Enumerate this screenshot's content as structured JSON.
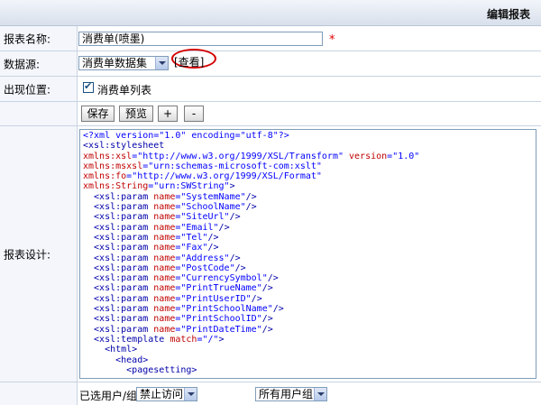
{
  "header": {
    "title": "编辑报表"
  },
  "form": {
    "name_label": "报表名称:",
    "name_value": "消费单(喷墨)",
    "required_mark": "*",
    "datasource_label": "数据源:",
    "datasource_value": "消费单数据集",
    "view_link": "[查看]",
    "position_label": "出现位置:",
    "position_checkbox_label": "消费单列表",
    "position_checked": true,
    "buttons": {
      "save": "保存",
      "preview": "预览",
      "plus": "+",
      "minus": "-"
    },
    "design_label": "报表设计:",
    "users_label": "已选用户/组",
    "users_select_value": "禁止访问",
    "all_groups_select_value": "所有用户组"
  },
  "code_lines": [
    [
      {
        "t": "<?xml version=\"1.0\" encoding=\"utf-8\"?>",
        "c": "pi"
      }
    ],
    [
      {
        "t": "<",
        "c": "tag"
      },
      {
        "t": "xsl:stylesheet",
        "c": "tag"
      }
    ],
    [
      {
        "t": "xmlns:xsl",
        "c": "attr"
      },
      {
        "t": "=\"http://www.w3.org/1999/XSL/Transform\" ",
        "c": "val"
      },
      {
        "t": "version",
        "c": "attr"
      },
      {
        "t": "=\"1.0\"",
        "c": "val"
      }
    ],
    [
      {
        "t": "xmlns:msxsl",
        "c": "attr"
      },
      {
        "t": "=\"urn:schemas-microsoft-com:xslt\"",
        "c": "val"
      }
    ],
    [
      {
        "t": "xmlns:fo",
        "c": "attr"
      },
      {
        "t": "=\"http://www.w3.org/1999/XSL/Format\"",
        "c": "val"
      }
    ],
    [
      {
        "t": "xmlns:String",
        "c": "attr"
      },
      {
        "t": "=\"urn:SWString\"",
        "c": "val"
      },
      {
        "t": ">",
        "c": "tag"
      }
    ],
    [
      {
        "t": "  <xsl:param ",
        "c": "tag"
      },
      {
        "t": "name",
        "c": "attr"
      },
      {
        "t": "=\"SystemName\"",
        "c": "val"
      },
      {
        "t": "/>",
        "c": "tag"
      }
    ],
    [
      {
        "t": "  <xsl:param ",
        "c": "tag"
      },
      {
        "t": "name",
        "c": "attr"
      },
      {
        "t": "=\"SchoolName\"",
        "c": "val"
      },
      {
        "t": "/>",
        "c": "tag"
      }
    ],
    [
      {
        "t": "  <xsl:param ",
        "c": "tag"
      },
      {
        "t": "name",
        "c": "attr"
      },
      {
        "t": "=\"SiteUrl\"",
        "c": "val"
      },
      {
        "t": "/>",
        "c": "tag"
      }
    ],
    [
      {
        "t": "  <xsl:param ",
        "c": "tag"
      },
      {
        "t": "name",
        "c": "attr"
      },
      {
        "t": "=\"Email\"",
        "c": "val"
      },
      {
        "t": "/>",
        "c": "tag"
      }
    ],
    [
      {
        "t": "  <xsl:param ",
        "c": "tag"
      },
      {
        "t": "name",
        "c": "attr"
      },
      {
        "t": "=\"Tel\"",
        "c": "val"
      },
      {
        "t": "/>",
        "c": "tag"
      }
    ],
    [
      {
        "t": "  <xsl:param ",
        "c": "tag"
      },
      {
        "t": "name",
        "c": "attr"
      },
      {
        "t": "=\"Fax\"",
        "c": "val"
      },
      {
        "t": "/>",
        "c": "tag"
      }
    ],
    [
      {
        "t": "  <xsl:param ",
        "c": "tag"
      },
      {
        "t": "name",
        "c": "attr"
      },
      {
        "t": "=\"Address\"",
        "c": "val"
      },
      {
        "t": "/>",
        "c": "tag"
      }
    ],
    [
      {
        "t": "  <xsl:param ",
        "c": "tag"
      },
      {
        "t": "name",
        "c": "attr"
      },
      {
        "t": "=\"PostCode\"",
        "c": "val"
      },
      {
        "t": "/>",
        "c": "tag"
      }
    ],
    [
      {
        "t": "  <xsl:param ",
        "c": "tag"
      },
      {
        "t": "name",
        "c": "attr"
      },
      {
        "t": "=\"CurrencySymbol\"",
        "c": "val"
      },
      {
        "t": "/>",
        "c": "tag"
      }
    ],
    [
      {
        "t": "  <xsl:param ",
        "c": "tag"
      },
      {
        "t": "name",
        "c": "attr"
      },
      {
        "t": "=\"PrintTrueName\"",
        "c": "val"
      },
      {
        "t": "/>",
        "c": "tag"
      }
    ],
    [
      {
        "t": "  <xsl:param ",
        "c": "tag"
      },
      {
        "t": "name",
        "c": "attr"
      },
      {
        "t": "=\"PrintUserID\"",
        "c": "val"
      },
      {
        "t": "/>",
        "c": "tag"
      }
    ],
    [
      {
        "t": "  <xsl:param ",
        "c": "tag"
      },
      {
        "t": "name",
        "c": "attr"
      },
      {
        "t": "=\"PrintSchoolName\"",
        "c": "val"
      },
      {
        "t": "/>",
        "c": "tag"
      }
    ],
    [
      {
        "t": "  <xsl:param ",
        "c": "tag"
      },
      {
        "t": "name",
        "c": "attr"
      },
      {
        "t": "=\"PrintSchoolID\"",
        "c": "val"
      },
      {
        "t": "/>",
        "c": "tag"
      }
    ],
    [
      {
        "t": "  <xsl:param ",
        "c": "tag"
      },
      {
        "t": "name",
        "c": "attr"
      },
      {
        "t": "=\"PrintDateTime\"",
        "c": "val"
      },
      {
        "t": "/>",
        "c": "tag"
      }
    ],
    [
      {
        "t": "  <xsl:template ",
        "c": "tag"
      },
      {
        "t": "match",
        "c": "attr"
      },
      {
        "t": "=\"/\"",
        "c": "val"
      },
      {
        "t": ">",
        "c": "tag"
      }
    ],
    [
      {
        "t": "    <html>",
        "c": "tag"
      }
    ],
    [
      {
        "t": "      <head>",
        "c": "tag"
      }
    ],
    [
      {
        "t": "        <pagesetting>",
        "c": "tag"
      }
    ]
  ]
}
